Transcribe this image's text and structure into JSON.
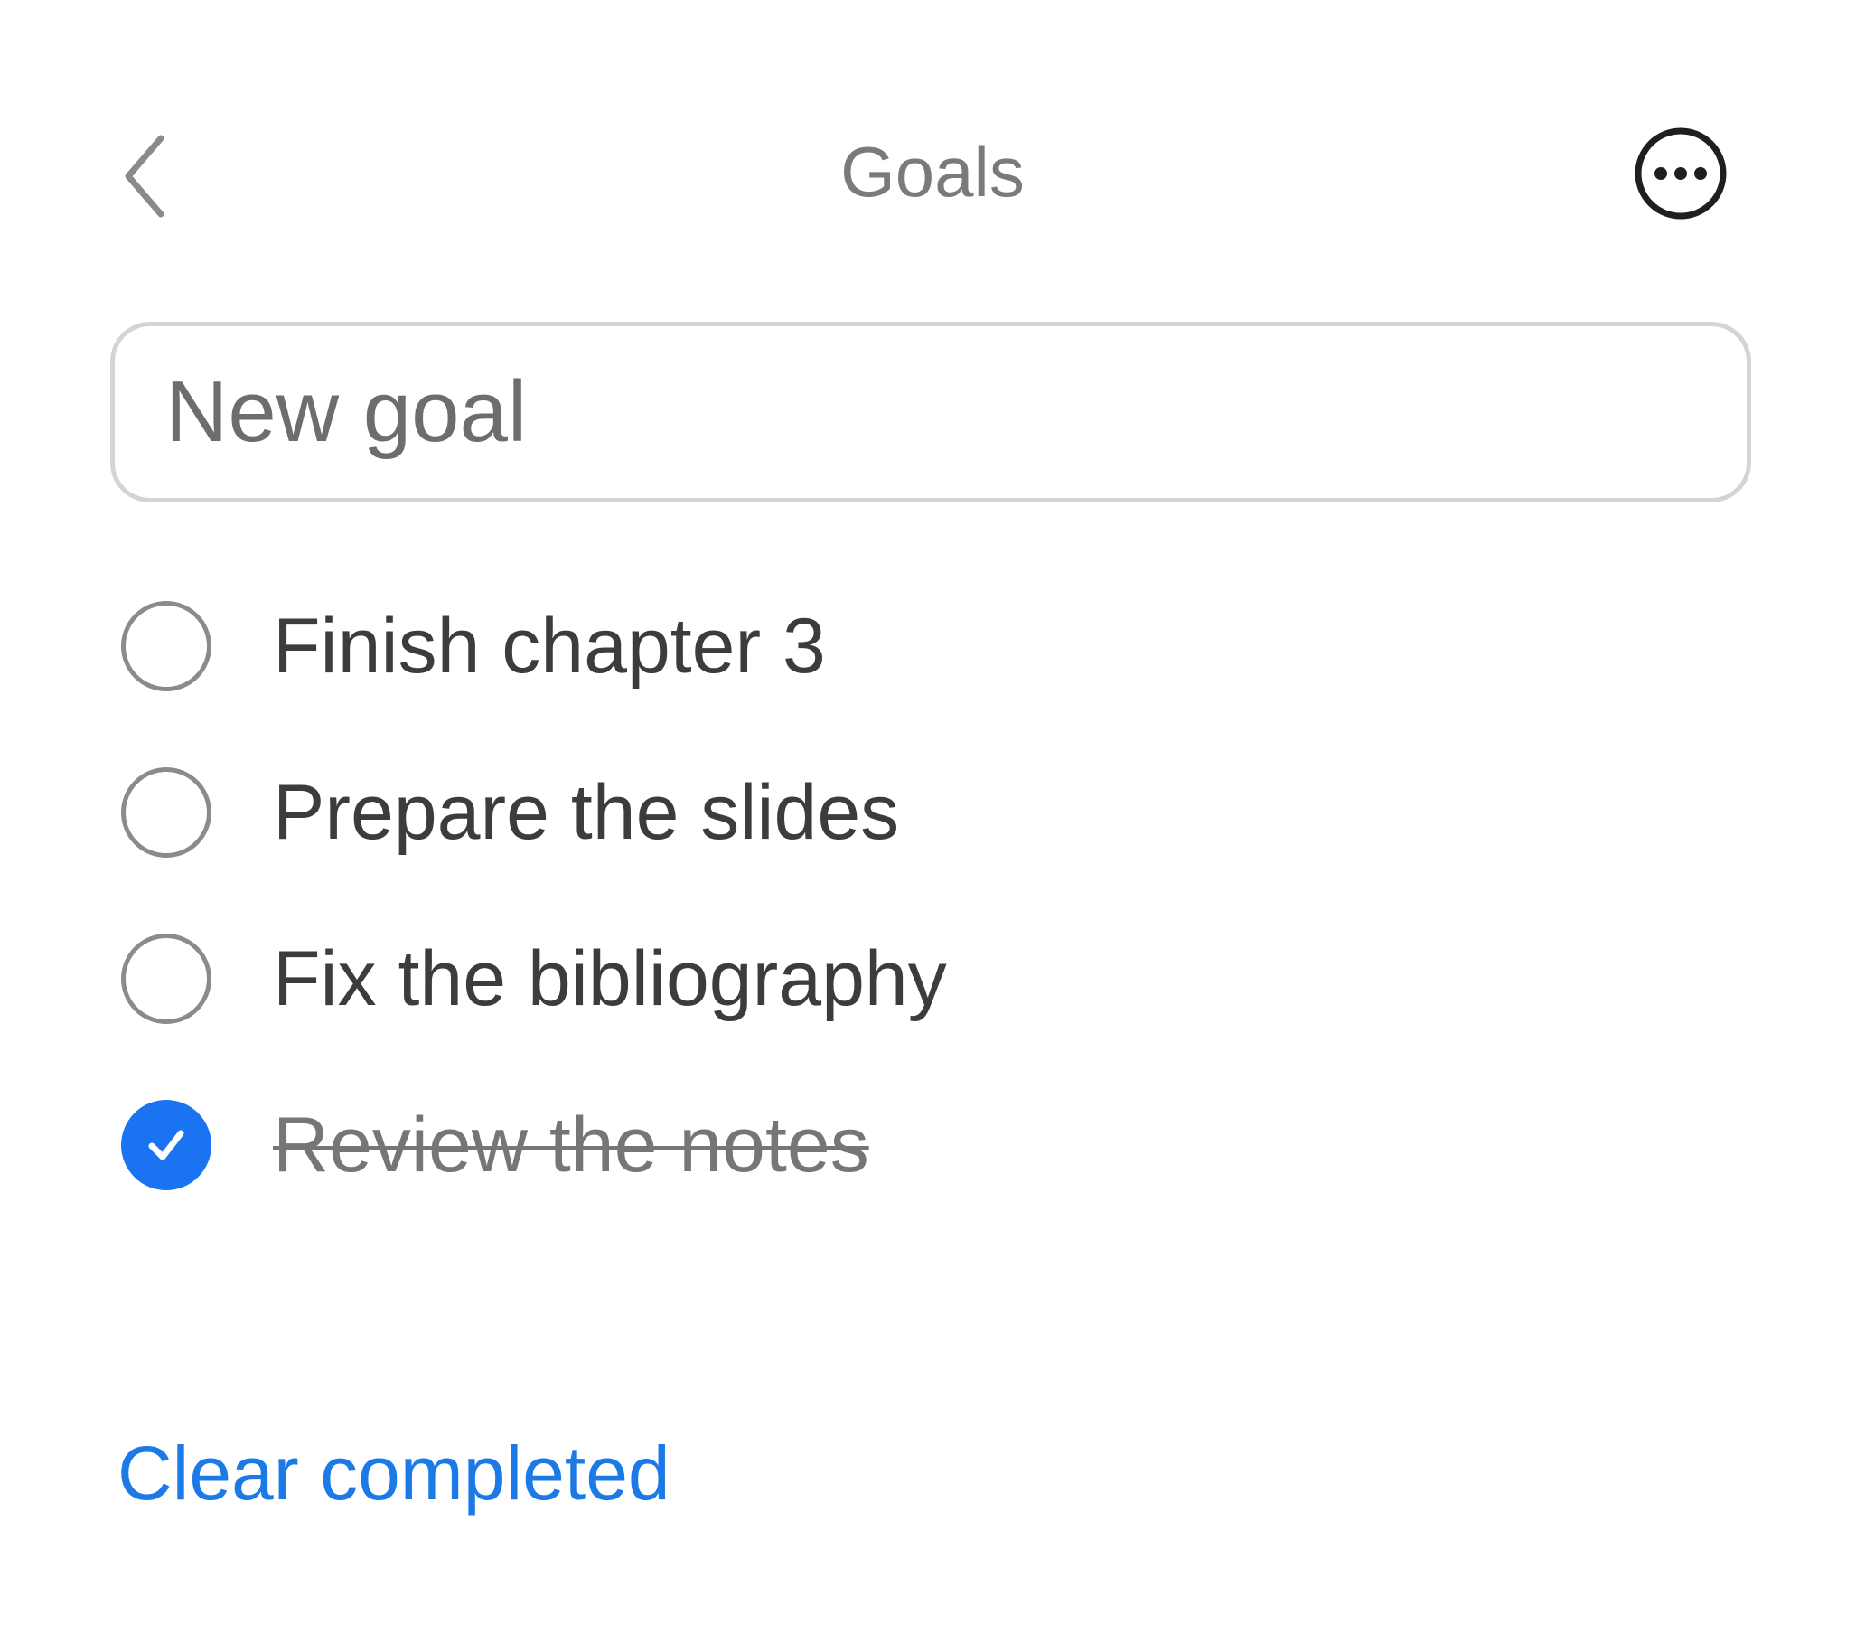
{
  "header": {
    "title": "Goals",
    "back_icon": "chevron-left-icon",
    "more_icon": "ellipsis-circle-icon"
  },
  "new_goal": {
    "placeholder": "New goal",
    "value": ""
  },
  "goals": [
    {
      "label": "Finish chapter 3",
      "completed": false
    },
    {
      "label": "Prepare the slides",
      "completed": false
    },
    {
      "label": "Fix the bibliography",
      "completed": false
    },
    {
      "label": "Review the notes",
      "completed": true
    }
  ],
  "footer": {
    "clear_label": "Clear completed"
  },
  "colors": {
    "accent": "#1a73f0",
    "link": "#1b7ae6",
    "title": "#7a7a7a",
    "text": "#3c3c3c"
  }
}
